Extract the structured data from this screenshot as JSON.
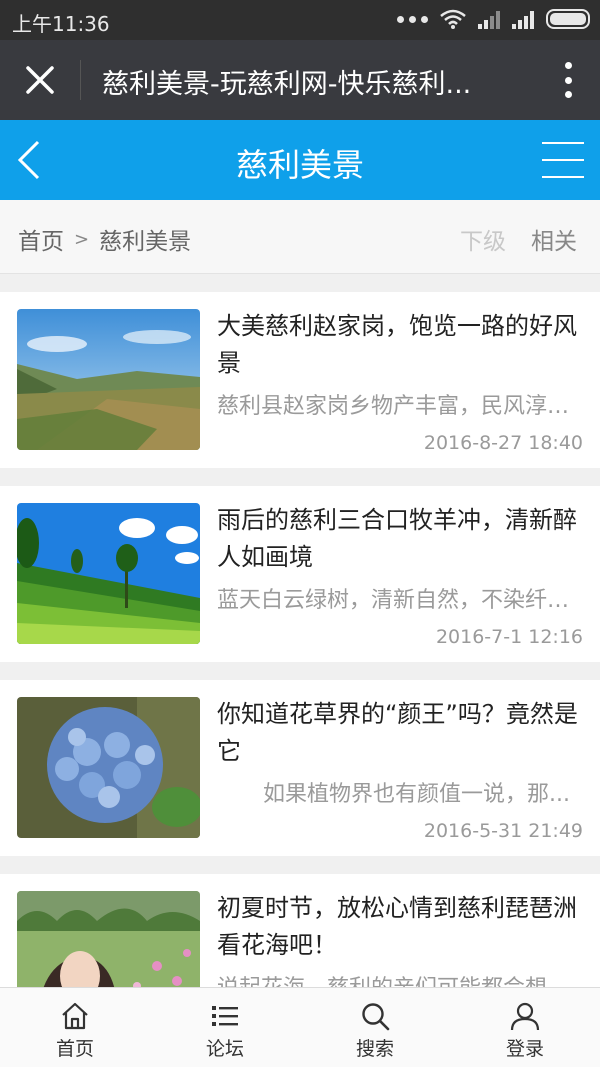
{
  "status_bar": {
    "time": "上午11:36"
  },
  "browser": {
    "title": "慈利美景-玩慈利网-快乐慈利..."
  },
  "header": {
    "title": "慈利美景"
  },
  "breadcrumb": {
    "home": "首页",
    "separator": ">",
    "current": "慈利美景",
    "tab_sub": "下级",
    "tab_related": "相关"
  },
  "articles": [
    {
      "title": "大美慈利赵家岗，饱览一路的好风景",
      "desc": "慈利县赵家岗乡物产丰富，民风淳朴...",
      "date": "2016-8-27 18:40"
    },
    {
      "title": "雨后的慈利三合口牧羊冲，清新醉人如画境",
      "desc": "蓝天白云绿树，清新自然，不染纤尘...",
      "date": "2016-7-1 12:16"
    },
    {
      "title": "你知道花草界的“颜王”吗？竟然是它",
      "desc": "如果植物界也有颜值一说，那...",
      "date": "2016-5-31 21:49"
    },
    {
      "title": "初夏时节，放松心情到慈利琵琶洲看花海吧！",
      "desc": "说起花海，慈利的亲们可能都会想"
    }
  ],
  "tabbar": {
    "home": "首页",
    "forum": "论坛",
    "search": "搜索",
    "login": "登录"
  },
  "colors": {
    "accent": "#0fa0ea",
    "titlebar": "#393a3f"
  }
}
